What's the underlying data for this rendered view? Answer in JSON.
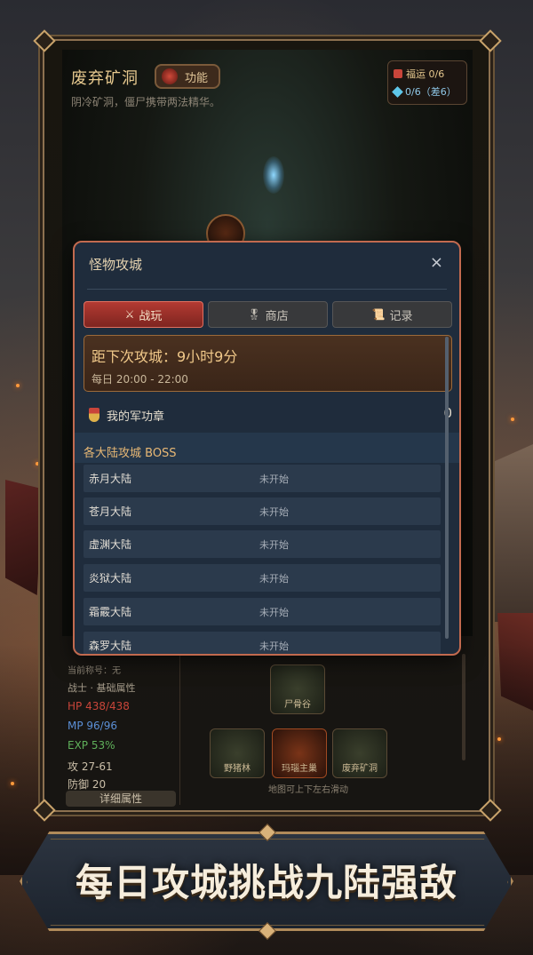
{
  "location": {
    "title": "废弃矿洞",
    "function_label": "功能",
    "description": "阴冷矿洞，僵尸携带两法精华。"
  },
  "resources": {
    "fortune": "福运 0/6",
    "diamond": "0/6（差6）"
  },
  "stats": {
    "title_line": "当前称号：无",
    "class_line": "战士 · 基础属性",
    "hp": "HP 438/438",
    "mp": "MP 96/96",
    "exp": "EXP 53%",
    "attack": "攻 27-61",
    "defense": "防御 20",
    "detail_button": "详细属性"
  },
  "map": {
    "tiles": [
      "尸骨谷",
      "野猪林",
      "玛瑙主巢",
      "废弃矿洞"
    ],
    "hint": "地图可上下左右滑动"
  },
  "modal": {
    "title": "怪物攻城",
    "close": "×",
    "tabs": [
      {
        "label": "战玩",
        "icon": "⚔"
      },
      {
        "label": "商店",
        "icon": "🎖"
      },
      {
        "label": "记录",
        "icon": "📜"
      }
    ],
    "countdown_title": "距下次攻城：9小时9分",
    "countdown_schedule": "每日 20:00 - 22:00",
    "merit_label": "我的军功章",
    "merit_value": "0",
    "boss_section_title": "各大陆攻城 BOSS",
    "bosses": [
      {
        "name": "赤月大陆",
        "status": "未开始"
      },
      {
        "name": "苍月大陆",
        "status": "未开始"
      },
      {
        "name": "虚渊大陆",
        "status": "未开始"
      },
      {
        "name": "炎狱大陆",
        "status": "未开始"
      },
      {
        "name": "霜霰大陆",
        "status": "未开始"
      },
      {
        "name": "森罗大陆",
        "status": "未开始"
      }
    ]
  },
  "banner": {
    "text": "每日攻城挑战九陆强敌"
  },
  "colors": {
    "modal_bg": "#1f2c3c",
    "modal_border": "#c26a4f",
    "active_tab": "#b33a32",
    "accent_gold": "#e8b875"
  }
}
